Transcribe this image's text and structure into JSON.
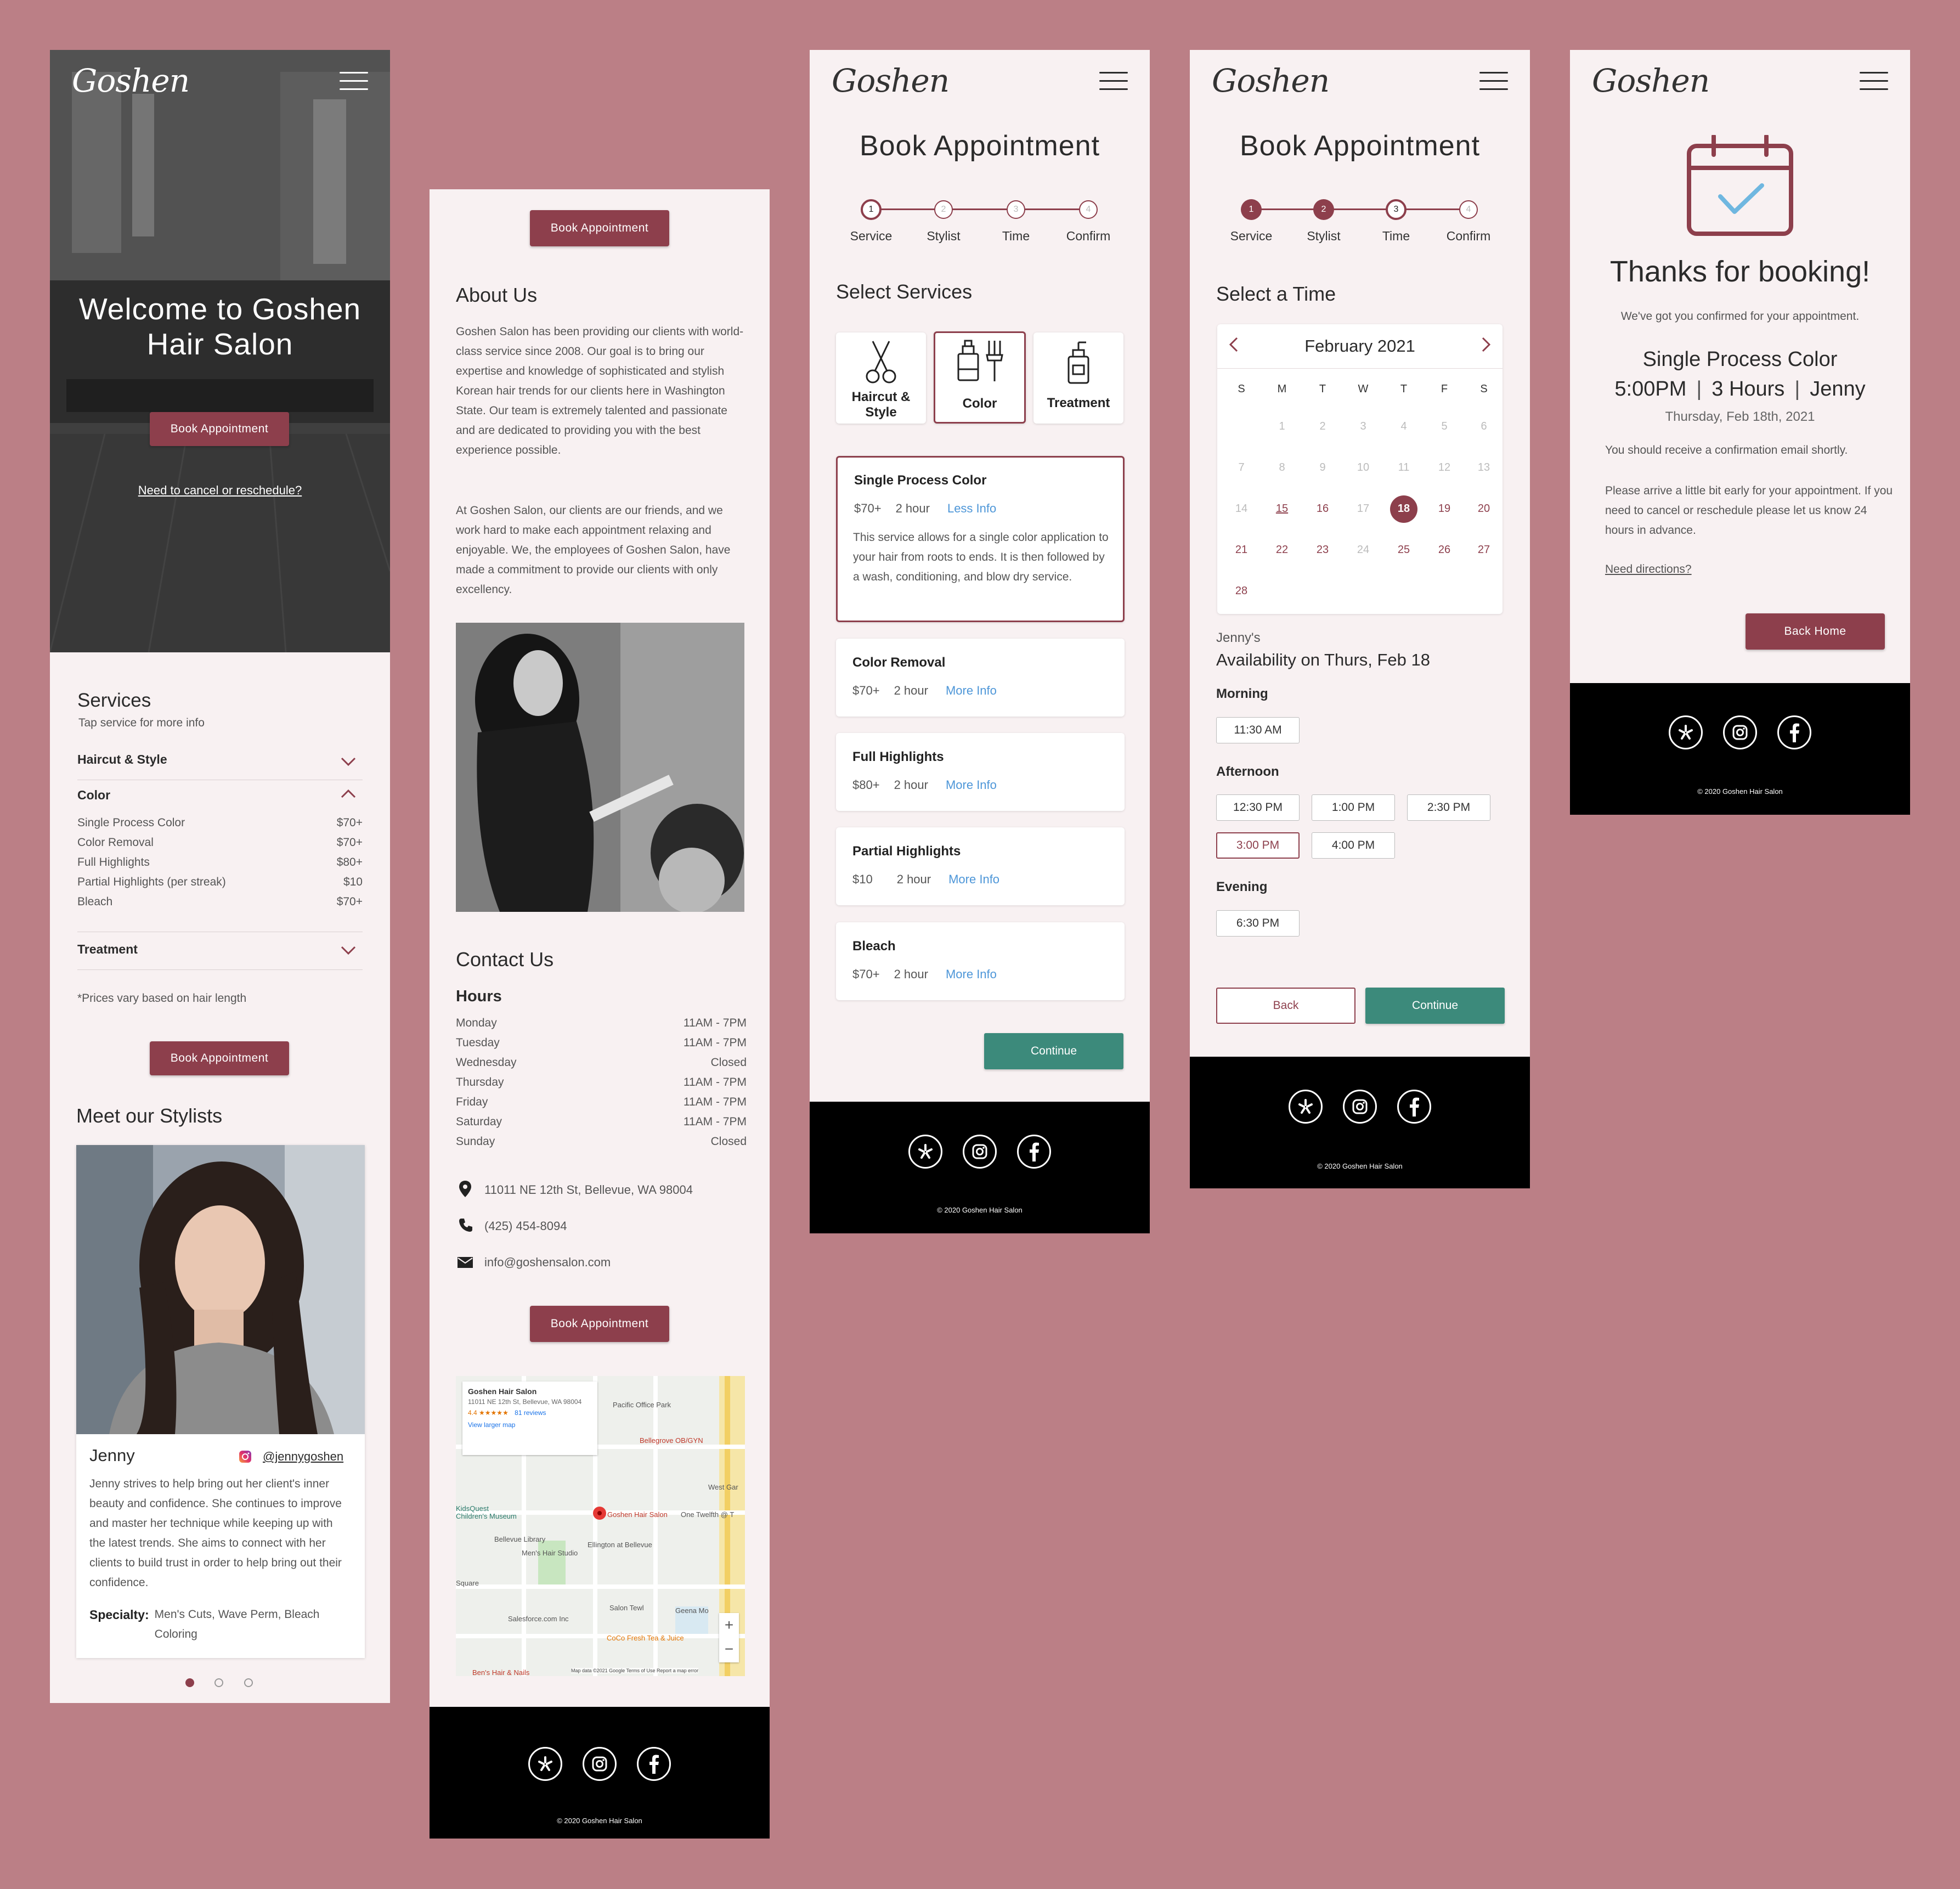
{
  "colors": {
    "background": "#bb7f86",
    "accent": "#8d3f4c",
    "teal": "#3c8a7b",
    "link": "#4d96d8",
    "screen": "#f8f1f2"
  },
  "brand": {
    "logo": "Goshen",
    "copyright": "© 2020 Goshen Hair Salon"
  },
  "home": {
    "hero_title_line1": "Welcome to Goshen",
    "hero_title_line2": "Hair Salon",
    "book_button": "Book Appointment",
    "cancel_link": "Need to cancel or reschedule?",
    "services_title": "Services",
    "services_subtitle": "Tap service for more info",
    "categories": [
      {
        "label": "Haircut & Style"
      },
      {
        "label": "Color"
      },
      {
        "label": "Treatment"
      }
    ],
    "color_items": [
      {
        "name": "Single Process Color",
        "price": "$70+"
      },
      {
        "name": "Color Removal",
        "price": "$70+"
      },
      {
        "name": "Full Highlights",
        "price": "$80+"
      },
      {
        "name": "Partial Highlights (per streak)",
        "price": "$10"
      },
      {
        "name": "Bleach",
        "price": "$70+"
      }
    ],
    "price_note": "*Prices vary based on hair length",
    "book_button_2": "Book Appointment",
    "stylists_title": "Meet our Stylists",
    "stylist_name": "Jenny",
    "stylist_handle": "@jennygoshen",
    "stylist_bio": "Jenny strives to help bring out her client's inner beauty and confidence. She continues to improve and master her technique while keeping up with the latest trends. She aims to connect with her clients to build trust in order to help bring out their confidence.",
    "specialty_label": "Specialty:",
    "specialty_value": "Men's Cuts, Wave Perm, Bleach Coloring"
  },
  "about": {
    "book_button": "Book Appointment",
    "title": "About Us",
    "para1": "Goshen Salon has been providing our clients with world-class service since 2008. Our goal is to bring our expertise and knowledge of sophisticated and stylish Korean hair trends for our clients here in Washington State. Our team is extremely talented and passionate and are dedicated to providing you with the best experience possible.",
    "para2": "At Goshen Salon, our clients are our friends, and we work hard to make each appointment relaxing and enjoyable. We, the employees of Goshen Salon, have made a commitment to provide our clients with only excellency.",
    "contact_title": "Contact Us",
    "hours_title": "Hours",
    "hours": [
      {
        "day": "Monday",
        "time": "11AM - 7PM"
      },
      {
        "day": "Tuesday",
        "time": "11AM - 7PM"
      },
      {
        "day": "Wednesday",
        "time": "Closed"
      },
      {
        "day": "Thursday",
        "time": "11AM - 7PM"
      },
      {
        "day": "Friday",
        "time": "11AM - 7PM"
      },
      {
        "day": "Saturday",
        "time": "11AM - 7PM"
      },
      {
        "day": "Sunday",
        "time": "Closed"
      }
    ],
    "address": "11011 NE 12th St, Bellevue, WA 98004",
    "phone": "(425) 454-8094",
    "email": "info@goshensalon.com",
    "book_button_2": "Book Appointment",
    "map": {
      "place_name": "Goshen Hair Salon",
      "place_address": "11011 NE 12th St, Bellevue, WA 98004",
      "rating": "4.4",
      "reviews": "81 reviews",
      "larger_map": "View larger map",
      "labels": [
        "Pacific Office Park",
        "Bellegrove OB/GYN",
        "KidsQuest Children's Museum",
        "Goshen Hair Salon",
        "One Twelfth @ T",
        "Bellevue Library",
        "Men's Hair Studio",
        "Ellington at Bellevue",
        "Salon Tewl",
        "Salesforce.com Inc",
        "Geena Mo",
        "CoCo Fresh Tea & Juice",
        "Ben's Hair & Nails",
        "West Gar",
        "Square"
      ],
      "attribution": "Map data ©2021 Google  Terms of Use  Report a map error"
    }
  },
  "booking_service": {
    "title": "Book Appointment",
    "steps": [
      {
        "num": "1",
        "label": "Service"
      },
      {
        "num": "2",
        "label": "Stylist"
      },
      {
        "num": "3",
        "label": "Time"
      },
      {
        "num": "4",
        "label": "Confirm"
      }
    ],
    "section_title": "Select Services",
    "categories": [
      {
        "label_1": "Haircut &",
        "label_2": "Style"
      },
      {
        "label": "Color"
      },
      {
        "label": "Treatment"
      }
    ],
    "services": [
      {
        "name": "Single Process Color",
        "price": "$70+",
        "duration": "2 hour",
        "link": "Less Info",
        "desc": "This service allows for a single color application to your hair from roots to ends. It is then followed by a wash, conditioning, and blow dry service."
      },
      {
        "name": "Color Removal",
        "price": "$70+",
        "duration": "2 hour",
        "link": "More Info"
      },
      {
        "name": "Full Highlights",
        "price": "$80+",
        "duration": "2 hour",
        "link": "More Info"
      },
      {
        "name": "Partial Highlights",
        "price": "$10",
        "duration": "2 hour",
        "link": "More Info"
      },
      {
        "name": "Bleach",
        "price": "$70+",
        "duration": "2 hour",
        "link": "More Info"
      }
    ],
    "continue": "Continue"
  },
  "booking_time": {
    "title": "Book Appointment",
    "steps": [
      {
        "num": "1",
        "label": "Service"
      },
      {
        "num": "2",
        "label": "Stylist"
      },
      {
        "num": "3",
        "label": "Time"
      },
      {
        "num": "4",
        "label": "Confirm"
      }
    ],
    "section_title": "Select a Time",
    "month": "February 2021",
    "weekdays": [
      "S",
      "M",
      "T",
      "W",
      "T",
      "F",
      "S"
    ],
    "weeks": [
      [
        "",
        "1",
        "2",
        "3",
        "4",
        "5",
        "6"
      ],
      [
        "7",
        "8",
        "9",
        "10",
        "11",
        "12",
        "13"
      ],
      [
        "14",
        "15",
        "16",
        "17",
        "18",
        "19",
        "20"
      ],
      [
        "21",
        "22",
        "23",
        "24",
        "25",
        "26",
        "27"
      ],
      [
        "28",
        "",
        "",
        "",
        "",
        "",
        ""
      ]
    ],
    "selected_day": "18",
    "available_days": [
      "15",
      "16",
      "19",
      "20",
      "21",
      "22",
      "23",
      "25",
      "26",
      "27",
      "28"
    ],
    "availability_stylist": "Jenny's",
    "availability_title": "Availability on Thurs, Feb 18",
    "morning_label": "Morning",
    "morning": [
      "11:30 AM"
    ],
    "afternoon_label": "Afternoon",
    "afternoon": [
      "12:30 PM",
      "1:00 PM",
      "2:30 PM",
      "3:00 PM",
      "4:00 PM"
    ],
    "selected_time": "3:00 PM",
    "evening_label": "Evening",
    "evening": [
      "6:30 PM"
    ],
    "back": "Back",
    "continue": "Continue"
  },
  "confirmation": {
    "title": "Thanks for booking!",
    "subtitle": "We've got you confirmed for your appointment.",
    "service": "Single Process Color",
    "time": "5:00PM",
    "duration": "3 Hours",
    "stylist": "Jenny",
    "date": "Thursday, Feb 18th, 2021",
    "email_note": "You should receive a confirmation email shortly.",
    "arrive_note": "Please arrive a little bit early for your appointment. If you need to cancel or reschedule please let us know 24 hours in advance.",
    "directions": "Need directions?",
    "back_home": "Back Home"
  },
  "icons": [
    "hamburger-icon",
    "chevron-down-icon",
    "chevron-up-icon",
    "instagram-icon",
    "yelp-icon",
    "facebook-icon",
    "map-pin-icon",
    "phone-icon",
    "mail-icon",
    "scissors-icon",
    "hair-dye-icon",
    "bottle-icon",
    "calendar-check-icon",
    "chevron-left-icon",
    "chevron-right-icon"
  ]
}
